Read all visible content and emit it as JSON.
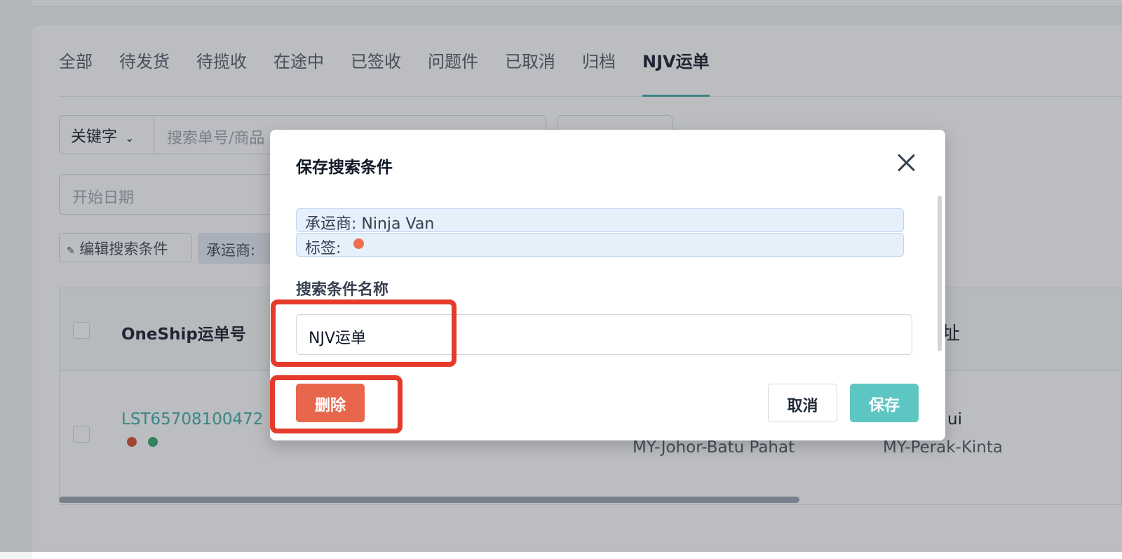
{
  "tabs": [
    "全部",
    "待发货",
    "待揽收",
    "在途中",
    "已签收",
    "问题件",
    "已取消",
    "归档",
    "NJV运单"
  ],
  "active_tab": "NJV运单",
  "filters": {
    "keyword_label": "关键字",
    "search_placeholder": "搜索单号/商品",
    "start_date_placeholder": "开始日期",
    "edit_search_label": "编辑搜索条件",
    "carrier_chip": "承运商:"
  },
  "table": {
    "col_waybill": "OneShip运单号",
    "col_address_partial": "址",
    "row": {
      "waybill": "LST65708100472",
      "sender_region": "MY-Johor-Batu Pahat",
      "receiver_name_partial": "ui",
      "receiver_region": "MY-Perak-Kinta"
    }
  },
  "modal": {
    "title": "保存搜索条件",
    "conditions": {
      "carrier": "承运商:  Ninja Van",
      "tag": "标签:"
    },
    "name_label": "搜索条件名称",
    "name_value": "NJV运单",
    "delete_label": "删除",
    "cancel_label": "取消",
    "save_label": "保存"
  },
  "colors": {
    "accent": "#3aa9a4",
    "save": "#5ec6c2",
    "delete": "#e8674c",
    "highlight": "#e53b2c",
    "tag_dot": "#ef6f4f"
  }
}
